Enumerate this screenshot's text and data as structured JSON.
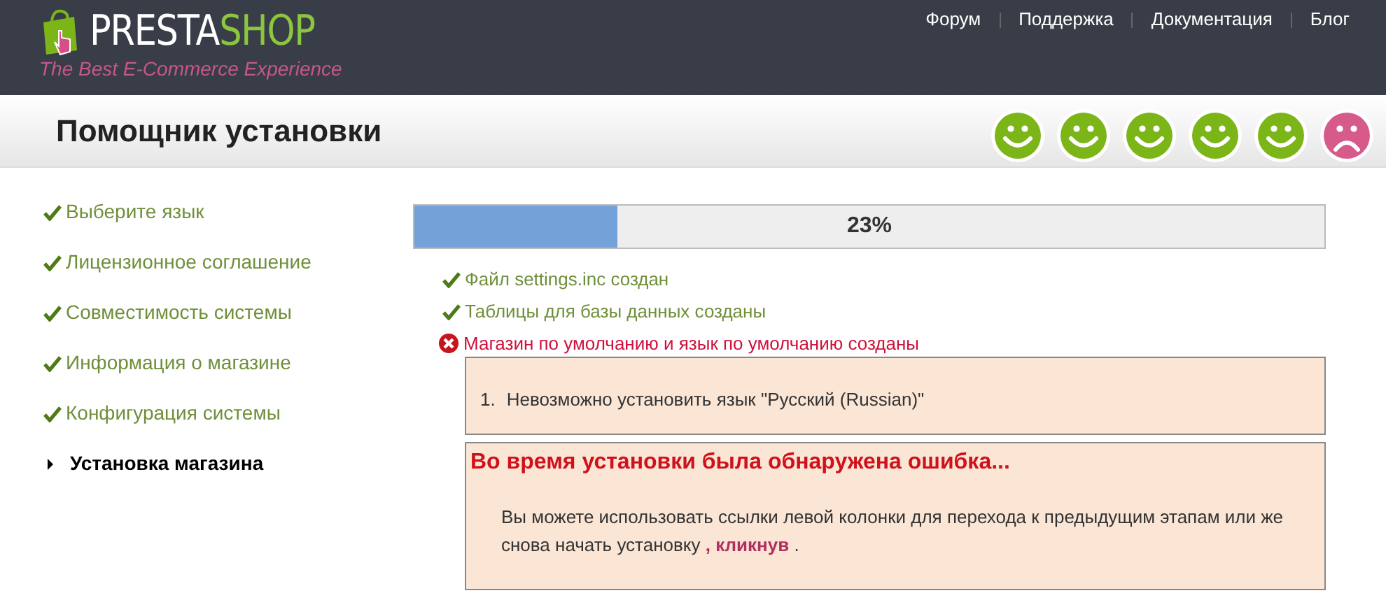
{
  "header": {
    "logo_word_1": "PRESTA",
    "logo_word_2": "SHOP",
    "tagline": "The Best E-Commerce Experience",
    "nav": [
      "Форум",
      "Поддержка",
      "Документация",
      "Блог"
    ]
  },
  "title": "Помощник установки",
  "moods": [
    {
      "kind": "happy"
    },
    {
      "kind": "happy"
    },
    {
      "kind": "happy"
    },
    {
      "kind": "happy"
    },
    {
      "kind": "happy"
    },
    {
      "kind": "sad"
    }
  ],
  "steps": [
    {
      "label": "Выберите язык",
      "done": true,
      "selected": false
    },
    {
      "label": "Лицензионное соглашение",
      "done": true,
      "selected": false
    },
    {
      "label": "Совместимость системы",
      "done": true,
      "selected": false
    },
    {
      "label": "Информация о магазине",
      "done": true,
      "selected": false
    },
    {
      "label": "Конфигурация системы",
      "done": true,
      "selected": false
    },
    {
      "label": "Установка магазина",
      "done": false,
      "selected": true
    }
  ],
  "progress": {
    "level": 0.223,
    "label": "23%"
  },
  "log": [
    {
      "text": "Файл settings.inc создан",
      "failed": false
    },
    {
      "text": "Таблицы для базы данных созданы",
      "failed": false
    },
    {
      "text": "Магазин по умолчанию и язык по умолчанию созданы",
      "failed": true
    }
  ],
  "errors": [
    {
      "number": "1.",
      "text": "Невозможно установить язык \"Русский (Russian)\""
    }
  ],
  "error_box": {
    "heading": "Во время установки была обнаружена ошибка...",
    "text_before": "Вы можете использовать ссылки левой колонки для перехода к предыдущим этапам или же снова начать установку",
    "link": ", кликнув",
    "text_after": "."
  }
}
